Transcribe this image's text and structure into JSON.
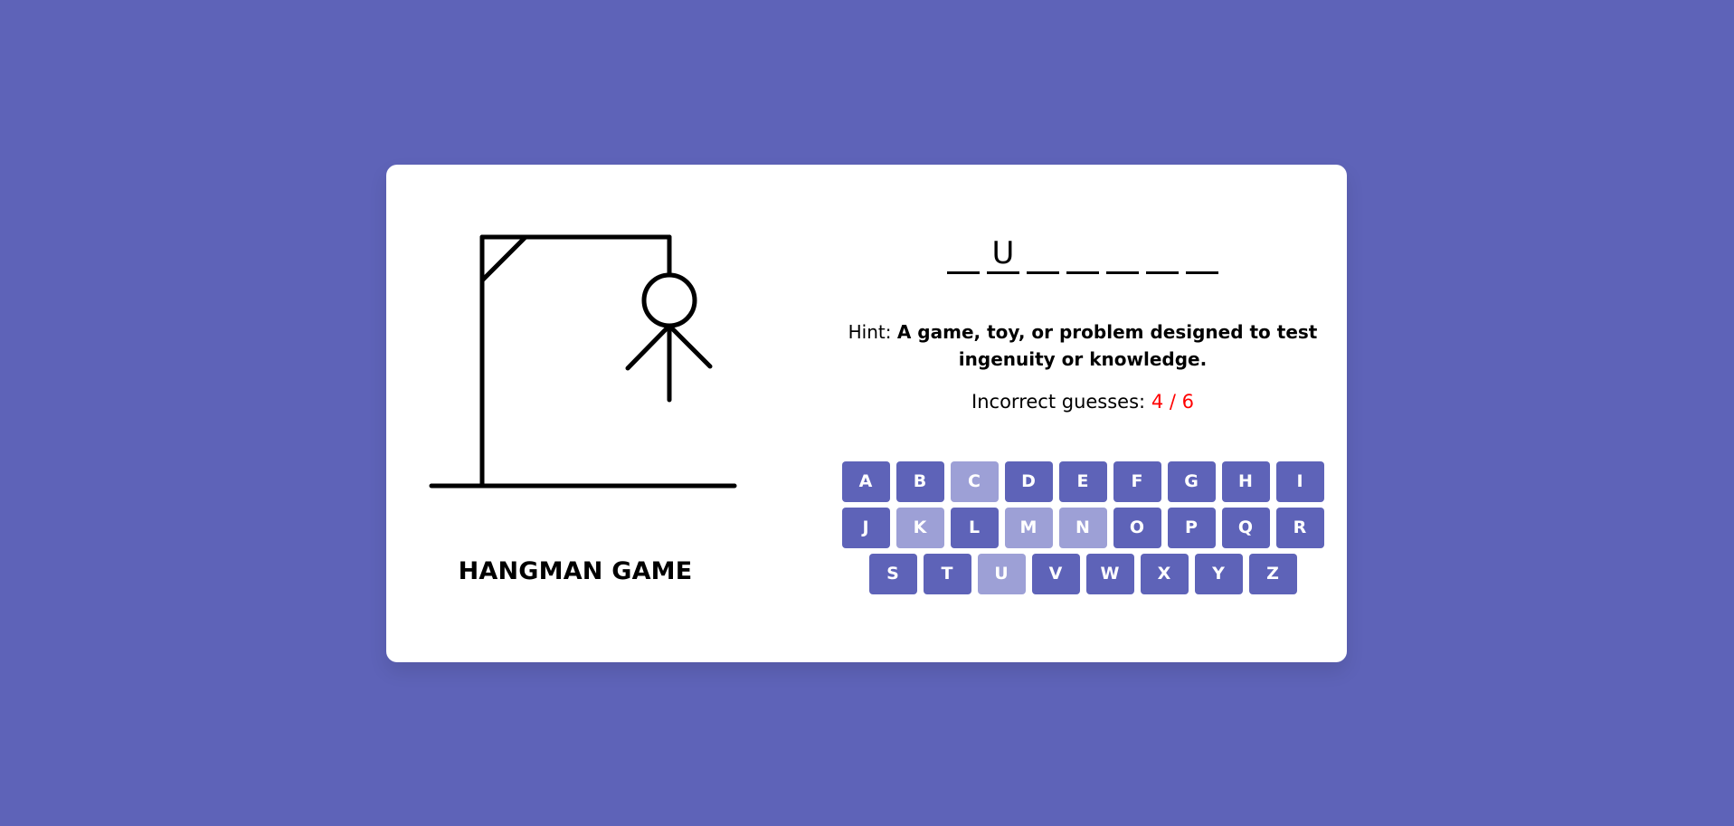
{
  "game": {
    "title": "HANGMAN GAME",
    "word_display": [
      "",
      "U",
      "",
      "",
      "",
      "",
      ""
    ],
    "hint_label": "Hint:",
    "hint_text": "A game, toy, or problem designed to test ingenuity or knowledge.",
    "guesses_label": "Incorrect guesses:",
    "guesses_count": "4 / 6",
    "wrong_guesses": 4,
    "max_guesses": 6
  },
  "keyboard": {
    "rows": [
      [
        "A",
        "B",
        "C",
        "D",
        "E",
        "F",
        "G",
        "H",
        "I"
      ],
      [
        "J",
        "K",
        "L",
        "M",
        "N",
        "O",
        "P",
        "Q",
        "R"
      ],
      [
        "S",
        "T",
        "U",
        "V",
        "W",
        "X",
        "Y",
        "Z"
      ]
    ],
    "used_letters": [
      "C",
      "K",
      "M",
      "N",
      "U"
    ]
  },
  "colors": {
    "background": "#5E63B8",
    "card": "#ffffff",
    "key_active": "#5E63B8",
    "key_disabled": "#9DA0D6",
    "incorrect_count": "#ff0000"
  }
}
